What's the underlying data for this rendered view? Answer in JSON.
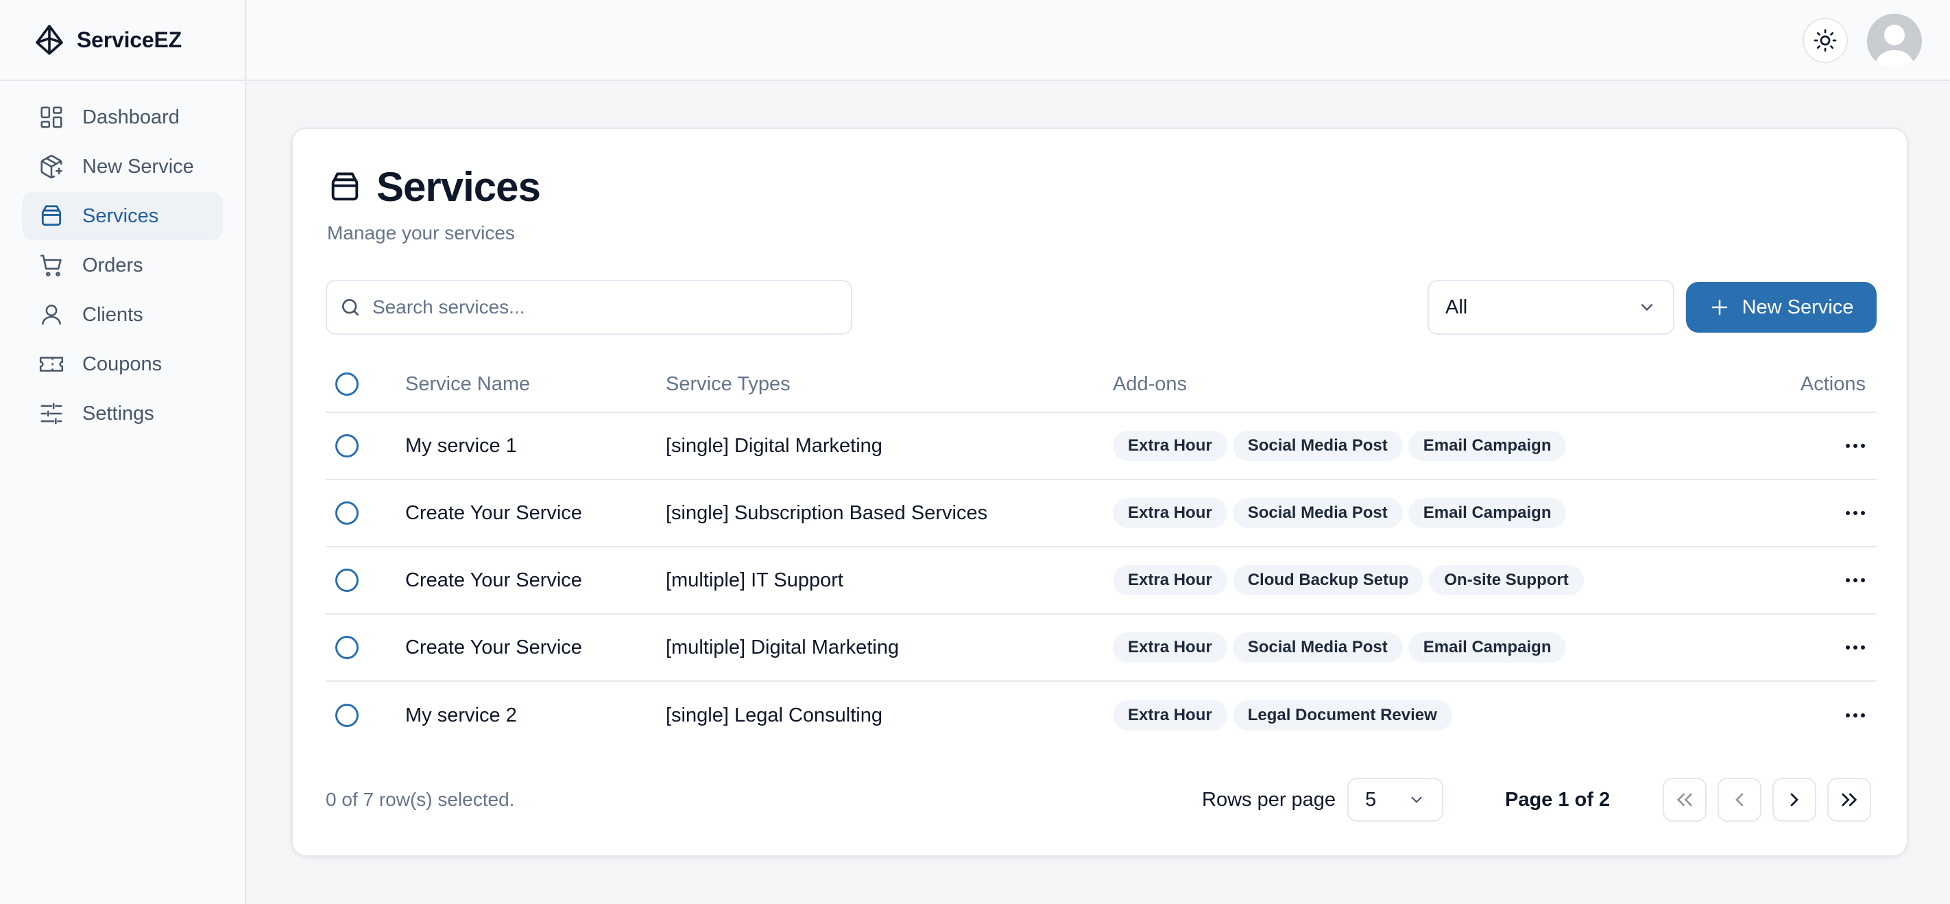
{
  "brand": {
    "name": "ServiceEZ"
  },
  "sidebar": {
    "items": [
      {
        "label": "Dashboard",
        "icon": "dashboard-icon",
        "active": false
      },
      {
        "label": "New Service",
        "icon": "package-plus-icon",
        "active": false
      },
      {
        "label": "Services",
        "icon": "box-icon",
        "active": true
      },
      {
        "label": "Orders",
        "icon": "cart-icon",
        "active": false
      },
      {
        "label": "Clients",
        "icon": "user-icon",
        "active": false
      },
      {
        "label": "Coupons",
        "icon": "ticket-icon",
        "active": false
      },
      {
        "label": "Settings",
        "icon": "sliders-icon",
        "active": false
      }
    ]
  },
  "header": {
    "theme_icon": "sun-icon",
    "avatar_icon": "user-avatar-icon"
  },
  "page": {
    "title": "Services",
    "subtitle": "Manage your services"
  },
  "toolbar": {
    "search_placeholder": "Search services...",
    "filter_value": "All",
    "new_button_label": "New Service"
  },
  "table": {
    "columns": [
      "Service Name",
      "Service Types",
      "Add-ons",
      "Actions"
    ],
    "rows": [
      {
        "name": "My service 1",
        "type": "[single] Digital Marketing",
        "addons": [
          "Extra Hour",
          "Social Media Post",
          "Email Campaign"
        ]
      },
      {
        "name": "Create Your Service",
        "type": "[single] Subscription Based Services",
        "addons": [
          "Extra Hour",
          "Social Media Post",
          "Email Campaign"
        ]
      },
      {
        "name": "Create Your Service",
        "type": "[multiple] IT Support",
        "addons": [
          "Extra Hour",
          "Cloud Backup Setup",
          "On-site Support"
        ]
      },
      {
        "name": "Create Your Service",
        "type": "[multiple] Digital Marketing",
        "addons": [
          "Extra Hour",
          "Social Media Post",
          "Email Campaign"
        ]
      },
      {
        "name": "My service 2",
        "type": "[single] Legal Consulting",
        "addons": [
          "Extra Hour",
          "Legal Document Review"
        ]
      }
    ]
  },
  "footer": {
    "selection_text": "0 of 7 row(s) selected.",
    "rows_per_page_label": "Rows per page",
    "rows_per_page_value": "5",
    "page_info": "Page 1 of 2"
  },
  "colors": {
    "accent": "#2a6fb0",
    "active_nav_bg": "#eef2f7",
    "badge_bg": "#f1f5f9"
  }
}
